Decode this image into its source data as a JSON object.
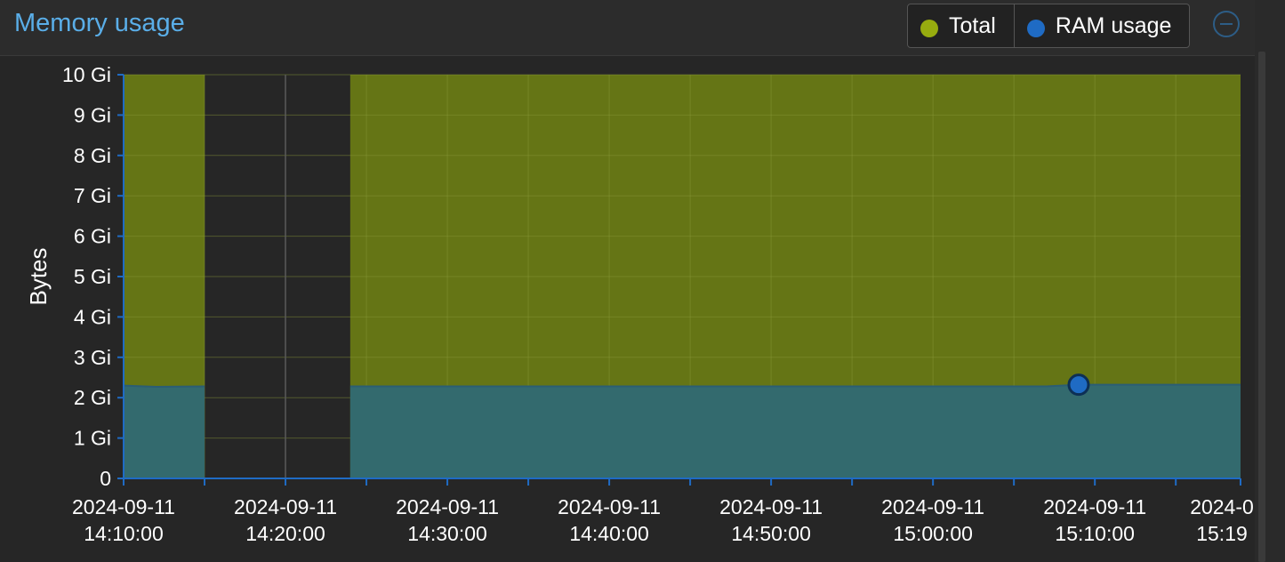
{
  "panel": {
    "title": "Memory usage"
  },
  "legend": [
    {
      "label": "Total",
      "color": "#97ac0f"
    },
    {
      "label": "RAM usage",
      "color": "#1f6bc4"
    }
  ],
  "colors": {
    "total_fill": "#657515",
    "ram_fill": "#336a6e",
    "ram_line": "#1f6bc4",
    "grid": "#8a9a3a",
    "gap_grid": "#5a5a5a",
    "axis": "#1f6bc4"
  },
  "chart_data": {
    "type": "area",
    "ylabel": "Bytes",
    "ylim": [
      0,
      10
    ],
    "y_unit": "Gi",
    "y_ticks": [
      "0",
      "1 Gi",
      "2 Gi",
      "3 Gi",
      "4 Gi",
      "5 Gi",
      "6 Gi",
      "7 Gi",
      "8 Gi",
      "9 Gi",
      "10 Gi"
    ],
    "xlim": [
      "2024-09-11 14:10:00",
      "2024-09-11 15:19:00"
    ],
    "x_ticks": [
      {
        "date": "2024-09-11",
        "time": "14:10:00"
      },
      {
        "date": "2024-09-11",
        "time": "14:20:00"
      },
      {
        "date": "2024-09-11",
        "time": "14:30:00"
      },
      {
        "date": "2024-09-11",
        "time": "14:40:00"
      },
      {
        "date": "2024-09-11",
        "time": "14:50:00"
      },
      {
        "date": "2024-09-11",
        "time": "15:00:00"
      },
      {
        "date": "2024-09-11",
        "time": "15:10:00"
      },
      {
        "date": "2024-0",
        "time": "15:19"
      }
    ],
    "grid": true,
    "series": [
      {
        "name": "Total",
        "segments": [
          {
            "x": [
              "2024-09-11 14:10:00",
              "2024-09-11 14:15:00"
            ],
            "y": [
              10,
              10
            ]
          },
          {
            "x": [
              "2024-09-11 14:24:00",
              "2024-09-11 15:19:00"
            ],
            "y": [
              10,
              10
            ]
          }
        ]
      },
      {
        "name": "RAM usage",
        "segments": [
          {
            "x": [
              "2024-09-11 14:10:00",
              "2024-09-11 14:12:00",
              "2024-09-11 14:15:00"
            ],
            "y": [
              2.3,
              2.27,
              2.28
            ]
          },
          {
            "x": [
              "2024-09-11 14:24:00",
              "2024-09-11 14:40:00",
              "2024-09-11 15:00:00",
              "2024-09-11 15:07:00",
              "2024-09-11 15:09:00",
              "2024-09-11 15:19:00"
            ],
            "y": [
              2.28,
              2.28,
              2.28,
              2.28,
              2.32,
              2.32
            ]
          }
        ],
        "highlight": {
          "x": "2024-09-11 15:09:00",
          "y": 2.32
        }
      }
    ]
  }
}
